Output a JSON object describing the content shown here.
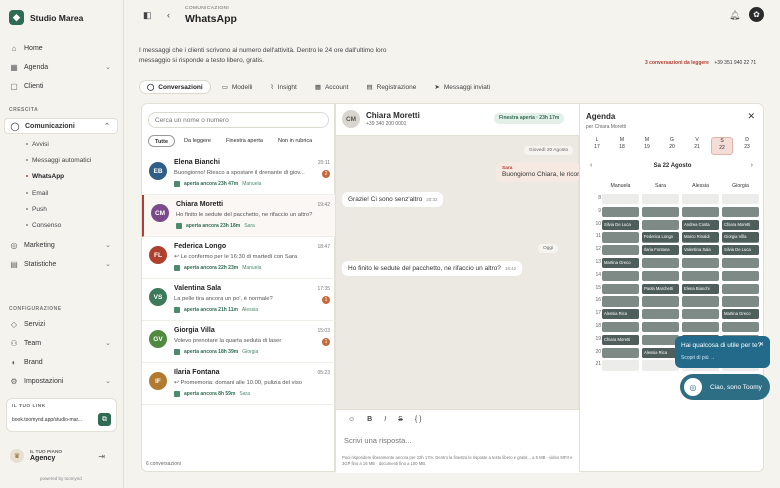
{
  "brand": {
    "name": "Studio Marea"
  },
  "nav": {
    "home": "Home",
    "agenda": "Agenda",
    "clienti": "Clienti",
    "crescita": "CRESCITA",
    "comunicazioni": "Comunicazioni",
    "subs": [
      "Avvisi",
      "Messaggi automatici",
      "WhatsApp",
      "Email",
      "Push",
      "Consenso"
    ],
    "marketing": "Marketing",
    "statistiche": "Statistiche",
    "configurazione": "CONFIGURAZIONE",
    "servizi": "Servizi",
    "team": "Team",
    "brand": "Brand",
    "impostazioni": "Impostazioni"
  },
  "link": {
    "label": "IL TUO LINK",
    "url": "book.toomynd.app/studio-mar..."
  },
  "plan": {
    "label": "IL TUO PIANO",
    "value": "Agency",
    "powered": "powered by toomynd"
  },
  "header": {
    "crumb": "COMUNICAZIONI",
    "title": "WhatsApp"
  },
  "desc": "I messaggi che i clienti scrivono al numero dell'attività. Dentro le 24 ore dall'ultimo loro messaggio si risponde a testo libero, gratis.",
  "unread": "3 conversazioni da leggere",
  "phone": "+39 351 940 22 71",
  "tabs": [
    "Conversazioni",
    "Modelli",
    "Insight",
    "Account",
    "Registrazione",
    "Messaggi inviati"
  ],
  "search": {
    "placeholder": "Cerca un nome o numero"
  },
  "filters": [
    "Tutte",
    "Da leggere",
    "Finestra aperta",
    "Non in rubrica"
  ],
  "conversations": [
    {
      "initials": "EB",
      "color": "#2f5f86",
      "name": "Elena Bianchi",
      "time": "20:11",
      "msg": "Buongiorno! Riesco a spostare il drenante di giov...",
      "meta": "aperta ancora 23h 47m",
      "who": "Manuela",
      "badge": "2"
    },
    {
      "initials": "CM",
      "color": "#7a4a8a",
      "name": "Chiara Moretti",
      "time": "19:42",
      "msg": "Ho finito le sedute del pacchetto, ne rifaccio un altro?",
      "meta": "aperta ancora 23h 18m",
      "who": "Sara",
      "badge": ""
    },
    {
      "initials": "FL",
      "color": "#b0402e",
      "name": "Federica Longo",
      "time": "18:47",
      "msg": "↩ Le confermo per le 16:30 di martedì con Sara",
      "meta": "aperta ancora 22h 23m",
      "who": "Manuela",
      "badge": ""
    },
    {
      "initials": "VS",
      "color": "#3c7a5a",
      "name": "Valentina Sala",
      "time": "17:35",
      "msg": "La pelle tira ancora un po', è normale?",
      "meta": "aperta ancora 21h 11m",
      "who": "Alessia",
      "badge": "1"
    },
    {
      "initials": "GV",
      "color": "#4f8a3e",
      "name": "Giorgia Villa",
      "time": "15:03",
      "msg": "Volevo prenotare la quarta seduta di laser",
      "meta": "aperta ancora 18h 39m",
      "who": "Giorgia",
      "badge": "1"
    },
    {
      "initials": "IF",
      "color": "#b27a2e",
      "name": "Ilaria Fontana",
      "time": "05:23",
      "msg": "↩ Promemoria: domani alle 10.00, pulizia del viso",
      "meta": "aperta ancora 8h 59m",
      "who": "Sara",
      "badge": ""
    }
  ],
  "count": "6 conversazioni",
  "chat": {
    "name": "Chiara Moretti",
    "phone": "+39 340 200 0001",
    "window": "Finestra aperta · 23h 17m",
    "date1": "Giovedì 20 Agosto",
    "from": "Sara",
    "msg1": "Buongiorno Chiara, le ricordiamo...",
    "msg2": "Grazie! Ci sono senz'altro",
    "time2": "20:33",
    "date2": "Oggi",
    "msg3": "Ho finito le sedute del pacchetto, ne rifaccio un altro?",
    "time3": "19:42",
    "placeholder": "Scrivi una risposta...",
    "footer": "Puoi rispondere liberamente ancora per 23h 17m. Dentro la finestra le risposte a testo libero e gratis... a 5 MB · video MP4 e 3GP fino a 16 MB · documenti fino a 100 MB."
  },
  "agenda": {
    "title": "Agenda",
    "sub": "per Chiara Moretti",
    "date": "Sa 22 Agosto",
    "days": [
      {
        "d": "L",
        "n": "17"
      },
      {
        "d": "M",
        "n": "18"
      },
      {
        "d": "M",
        "n": "19"
      },
      {
        "d": "G",
        "n": "20"
      },
      {
        "d": "V",
        "n": "21"
      },
      {
        "d": "S",
        "n": "22"
      },
      {
        "d": "D",
        "n": "23"
      }
    ],
    "staff": [
      "Manuela",
      "Sara",
      "Alessia",
      "Giorgia"
    ],
    "hours": [
      "8",
      "9",
      "10",
      "11",
      "12",
      "13",
      "14",
      "15",
      "16",
      "17",
      "18",
      "19",
      "20",
      "21"
    ],
    "appts": [
      {
        "h": 10,
        "c": 0,
        "l": "Silvia De Luca",
        "s": "dark"
      },
      {
        "h": 10,
        "c": 2,
        "l": "Andrea Costa",
        "s": "dark"
      },
      {
        "h": 10,
        "c": 3,
        "l": "Chiara Moretti",
        "s": "dark"
      },
      {
        "h": 11,
        "c": 1,
        "l": "Federica Longo",
        "s": "dark"
      },
      {
        "h": 11,
        "c": 2,
        "l": "Marco Rinaldi",
        "s": "dark"
      },
      {
        "h": 11,
        "c": 3,
        "l": "Giorgia Villa",
        "s": "dark"
      },
      {
        "h": 12,
        "c": 1,
        "l": "Ilaria Fontana",
        "s": "dark"
      },
      {
        "h": 12,
        "c": 2,
        "l": "Valentina Sala",
        "s": "dark"
      },
      {
        "h": 12,
        "c": 3,
        "l": "Silvia De Luca",
        "s": "dark"
      },
      {
        "h": 13,
        "c": 0,
        "l": "Martina Greco",
        "s": "dark"
      },
      {
        "h": 15,
        "c": 1,
        "l": "Paola Marchetti",
        "s": "dark"
      },
      {
        "h": 15,
        "c": 2,
        "l": "Elena Bianchi",
        "s": "dark"
      },
      {
        "h": 17,
        "c": 0,
        "l": "Alessia Rica",
        "s": "dark"
      },
      {
        "h": 17,
        "c": 3,
        "l": "Martina Greco",
        "s": "dark"
      },
      {
        "h": 19,
        "c": 0,
        "l": "Chiara Moretti",
        "s": "dark"
      },
      {
        "h": 19,
        "c": 2,
        "l": "Chiara Moretti",
        "s": "dark"
      },
      {
        "h": 20,
        "c": 1,
        "l": "Alessia Rica",
        "s": "dark"
      },
      {
        "h": 20,
        "c": 2,
        "l": "Martina Greco",
        "s": "dark"
      }
    ]
  },
  "toast": {
    "q": "Hai qualcosa di utile per te?",
    "link": "Scopri di più →",
    "bot": "Ciao, sono Toomy"
  }
}
